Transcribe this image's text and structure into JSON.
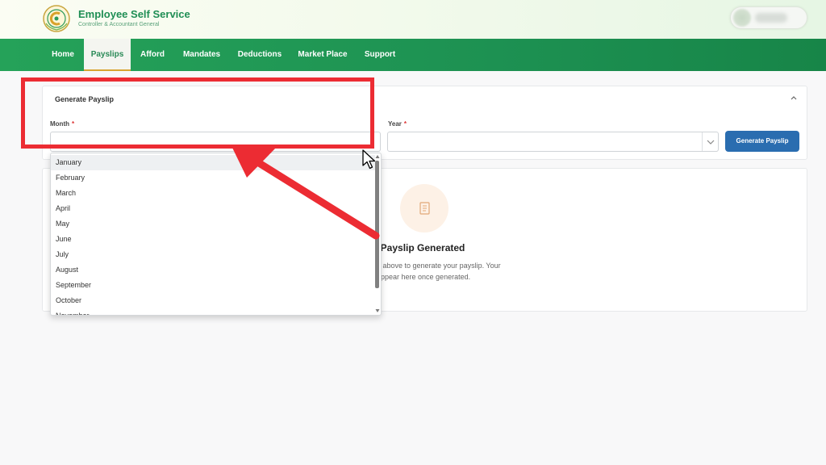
{
  "app": {
    "title": "Employee Self Service",
    "subtitle": "Controller & Accountant General"
  },
  "nav": {
    "items": [
      {
        "label": "Home"
      },
      {
        "label": "Payslips"
      },
      {
        "label": "Afford"
      },
      {
        "label": "Mandates"
      },
      {
        "label": "Deductions"
      },
      {
        "label": "Market Place"
      },
      {
        "label": "Support"
      }
    ],
    "active": "Payslips"
  },
  "form": {
    "title": "Generate Payslip",
    "month_label": "Month",
    "year_label": "Year",
    "required_mark": "*",
    "month_value": "",
    "year_value": "",
    "button_label": "Generate Payslip"
  },
  "dropdown": {
    "options": [
      "January",
      "February",
      "March",
      "April",
      "May",
      "June",
      "July",
      "August",
      "September",
      "October",
      "November"
    ],
    "highlighted": "January"
  },
  "empty_state": {
    "title": "o Payslip Generated",
    "desc_line1": "d year above to generate your payslip. Your",
    "desc_line2": "t will appear here once generated."
  },
  "colors": {
    "brand_green": "#1f8e54",
    "nav_green": "#1d9152",
    "button_blue": "#2a6db0",
    "annotation_red": "#ec2c33"
  },
  "icons": {
    "logo": "crest-logo-icon",
    "collapse": "chevron-up-icon",
    "select": "chevron-down-icon",
    "empty": "document-icon",
    "cursor": "mouse-pointer-icon"
  }
}
